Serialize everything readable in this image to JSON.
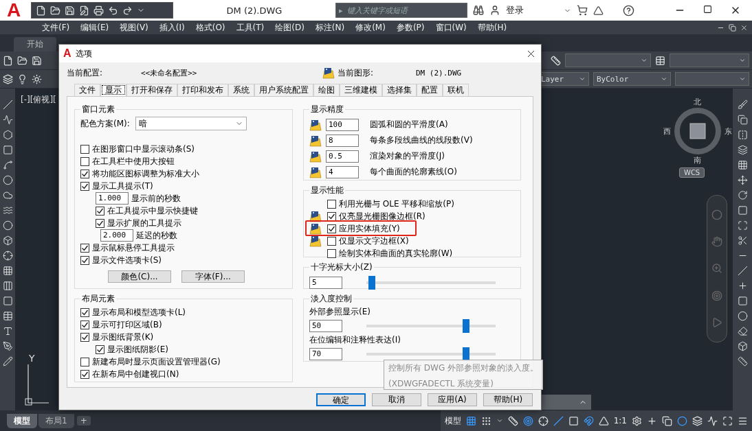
{
  "app": {
    "logo": "A",
    "title": "DM (2).DWG",
    "search_arrow": "▸",
    "search_placeholder": "键入关键字或短语",
    "login": "登录",
    "menu": [
      "文件(F)",
      "编辑(E)",
      "视图(V)",
      "插入(I)",
      "格式(O)",
      "工具(T)",
      "绘图(D)",
      "标注(N)",
      "修改(M)",
      "参数(P)",
      "窗口(W)",
      "帮助(H)"
    ],
    "file_tabs": [
      {
        "label": "开始",
        "selected": false
      }
    ],
    "layer_fields": [
      "Layer",
      "ByColor"
    ],
    "viewport_label": "[-][俯视][",
    "compass": {
      "north": "北",
      "west": "西",
      "east": "东",
      "south": "南",
      "ucs": "WCS"
    },
    "axis_label": "Y",
    "layout_tabs": [
      {
        "label": "模型",
        "selected": true
      },
      {
        "label": "布局1",
        "selected": false
      }
    ],
    "add_tab": "+",
    "status": {
      "model": "模型",
      "scale": "1:1"
    }
  },
  "dialog": {
    "logo": "A",
    "title": "选项",
    "profile_label": "当前配置:",
    "profile": "<<未命名配置>>",
    "drawing_label": "当前图形:",
    "drawing": "DM (2).DWG",
    "tabs": [
      {
        "label": "文件",
        "selected": false
      },
      {
        "label": "显示",
        "selected": true
      },
      {
        "label": "打开和保存",
        "selected": false
      },
      {
        "label": "打印和发布",
        "selected": false
      },
      {
        "label": "系统",
        "selected": false
      },
      {
        "label": "用户系统配置",
        "selected": false
      },
      {
        "label": "绘图",
        "selected": false
      },
      {
        "label": "三维建模",
        "selected": false
      },
      {
        "label": "选择集",
        "selected": false
      },
      {
        "label": "配置",
        "selected": false
      },
      {
        "label": "联机",
        "selected": false
      }
    ],
    "window_elements": {
      "title": "窗口元素",
      "scheme_label": "配色方案(M):",
      "scheme": "暗",
      "options": [
        {
          "kind": "checkbox",
          "label": "在图形窗口中显示滚动条(S)",
          "checked": false
        },
        {
          "kind": "checkbox",
          "label": "在工具栏中使用大按钮",
          "checked": false
        },
        {
          "kind": "checkbox",
          "label": "将功能区图标调整为标准大小",
          "checked": true
        },
        {
          "kind": "checkbox",
          "label": "显示工具提示(T)",
          "checked": true,
          "children": [
            {
              "kind": "number",
              "value": "1.000",
              "label": "显示前的秒数"
            },
            {
              "kind": "checkbox",
              "label": "在工具提示中显示快捷键",
              "checked": true
            },
            {
              "kind": "checkbox",
              "label": "显示扩展的工具提示",
              "checked": true,
              "children": [
                {
                  "kind": "number",
                  "value": "2.000",
                  "label": "延迟的秒数"
                }
              ]
            }
          ]
        },
        {
          "kind": "checkbox",
          "label": "显示鼠标悬停工具提示",
          "checked": true
        },
        {
          "kind": "checkbox",
          "label": "显示文件选项卡(S)",
          "checked": true
        }
      ],
      "buttons": [
        "颜色(C)...",
        "字体(F)..."
      ]
    },
    "layout_elements": {
      "title": "布局元素",
      "options": [
        {
          "kind": "checkbox",
          "label": "显示布局和模型选项卡(L)",
          "checked": true
        },
        {
          "kind": "checkbox",
          "label": "显示可打印区域(B)",
          "checked": true
        },
        {
          "kind": "checkbox",
          "label": "显示图纸背景(K)",
          "checked": true,
          "children": [
            {
              "kind": "checkbox",
              "label": "显示图纸阴影(E)",
              "checked": true
            }
          ]
        },
        {
          "kind": "checkbox",
          "label": "新建布局时显示页面设置管理器(G)",
          "checked": false
        },
        {
          "kind": "checkbox",
          "label": "在新布局中创建视口(N)",
          "checked": true
        }
      ]
    },
    "precision": {
      "title": "显示精度",
      "rows": [
        {
          "value": "100",
          "label": "圆弧和圆的平滑度(A)"
        },
        {
          "value": "8",
          "label": "每条多段线曲线的线段数(V)"
        },
        {
          "value": "0.5",
          "label": "渲染对象的平滑度(J)"
        },
        {
          "value": "4",
          "label": "每个曲面的轮廓素线(O)"
        }
      ]
    },
    "performance": {
      "title": "显示性能",
      "options": [
        {
          "label": "利用光栅与 OLE 平移和缩放(P)",
          "checked": false,
          "drawing_icon": false,
          "highlighted": false
        },
        {
          "label": "仅亮显光栅图像边框(R)",
          "checked": true,
          "drawing_icon": true,
          "highlighted": false
        },
        {
          "label": "应用实体填充(Y)",
          "checked": true,
          "drawing_icon": true,
          "highlighted": true
        },
        {
          "label": "仅显示文字边框(X)",
          "checked": false,
          "drawing_icon": true,
          "highlighted": false
        },
        {
          "label": "绘制实体和曲面的真实轮廓(W)",
          "checked": false,
          "drawing_icon": false,
          "highlighted": false
        }
      ]
    },
    "crosshair": {
      "title": "十字光标大小(Z)",
      "value": "5",
      "level": 0.04
    },
    "fade": {
      "title": "淡入度控制",
      "rows": [
        {
          "label": "外部参照显示(E)",
          "value": "50",
          "level": 0.77
        },
        {
          "label": "在位编辑和注释性表达(I)",
          "value": "70",
          "level": 0.77
        }
      ]
    },
    "tooltip": [
      "控制所有 DWG 外部参照对象的淡入度。",
      "(XDWGFADECTL 系统变量)"
    ],
    "buttons": [
      {
        "label": "确定",
        "default": true
      },
      {
        "label": "取消",
        "default": false
      },
      {
        "label": "应用(A)",
        "default": false
      },
      {
        "label": "帮助(H)",
        "default": false
      }
    ]
  }
}
